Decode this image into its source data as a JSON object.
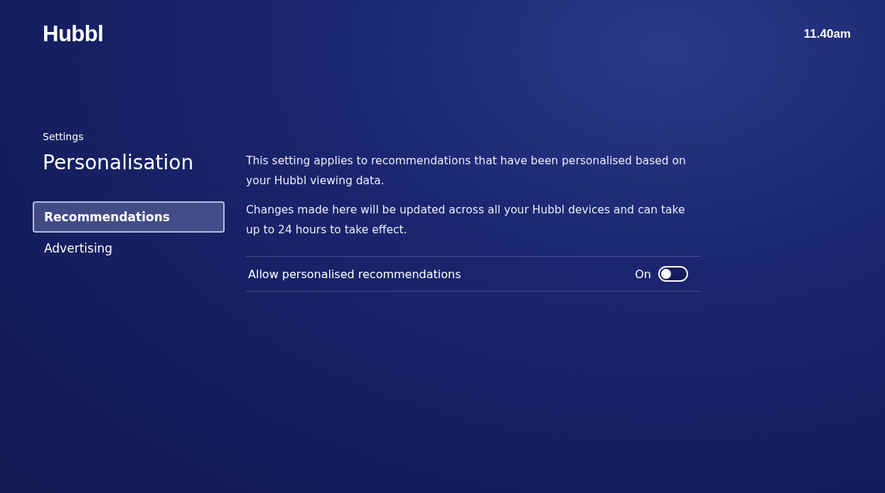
{
  "header": {
    "logo": "Hubbl",
    "time": "11.40am"
  },
  "sidebar": {
    "breadcrumb": "Settings",
    "title": "Personalisation",
    "items": [
      {
        "label": "Recommendations",
        "selected": true
      },
      {
        "label": "Advertising",
        "selected": false
      }
    ]
  },
  "content": {
    "paragraphs": [
      "This setting applies to recommendations that have been personalised based on your Hubbl viewing data.",
      "Changes made here will be updated across all your Hubbl devices and can take up to 24 hours to take effect."
    ],
    "settings": [
      {
        "kind": "toggle",
        "label": "Allow personalised recommendations",
        "value": "On",
        "on": false
      }
    ]
  }
}
